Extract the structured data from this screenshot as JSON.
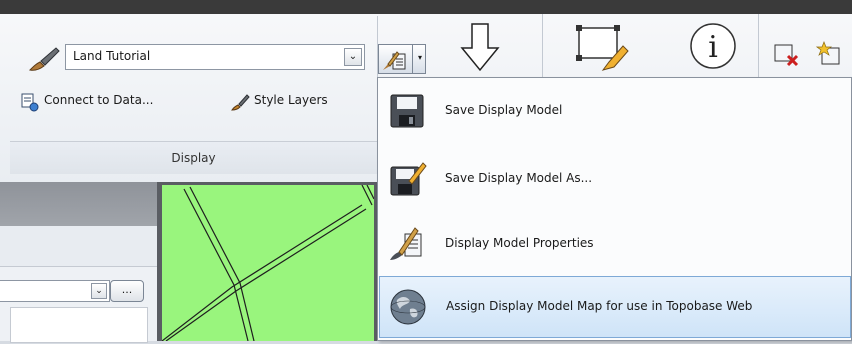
{
  "ribbon": {
    "display_model_selector": {
      "value": "Land Tutorial",
      "dropdown_glyph": "⌄"
    },
    "connect_label": "Connect to Data...",
    "style_layers_label": "Style Layers",
    "panel_title": "Display",
    "split_arrow_glyph": "▾"
  },
  "left_panel": {
    "ellipsis_label": "...",
    "dropdown_glyph": "⌄"
  },
  "menu": {
    "items": [
      {
        "label": "Save Display Model",
        "icon": "floppy-disk-icon"
      },
      {
        "label": "Save Display Model As...",
        "icon": "floppy-disk-pencil-icon"
      },
      {
        "label": "Display Model Properties",
        "icon": "display-model-properties-icon"
      },
      {
        "label": "Assign Display Model Map for use in Topobase Web",
        "icon": "globe-icon"
      }
    ]
  },
  "colors": {
    "map_fill": "#99f57d",
    "menu_highlight": "#cfe4f8",
    "ribbon_bg": "#eef1f5"
  }
}
